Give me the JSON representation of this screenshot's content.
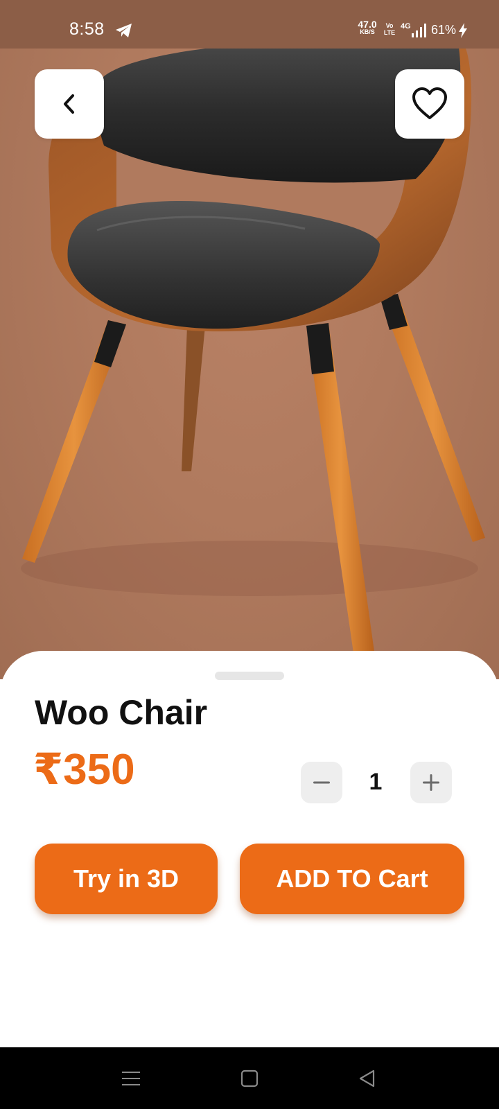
{
  "status_bar": {
    "time": "8:58",
    "network_speed_value": "47.0",
    "network_speed_unit": "KB/S",
    "volte_top": "Vo",
    "volte_bottom": "LTE",
    "network_type": "4G",
    "battery": "61%",
    "icons": [
      "telegram-icon",
      "signal-icon",
      "charging-bolt-icon"
    ]
  },
  "header": {
    "back_icon": "chevron-left-icon",
    "favorite_icon": "heart-outline-icon"
  },
  "product": {
    "image": "wooden-chair-with-black-leather-seat",
    "name": "Woo Chair",
    "price": "₹350",
    "quantity": "1"
  },
  "quantity_controls": {
    "decrement_icon": "minus-icon",
    "increment_icon": "plus-icon"
  },
  "actions": {
    "try_3d_label": "Try in 3D",
    "add_to_cart_label": "ADD TO Cart"
  },
  "navigation_bar": {
    "icons": [
      "menu-lines-icon",
      "square-home-icon",
      "triangle-back-icon"
    ]
  },
  "colors": {
    "accent": "#ec6b17",
    "hero_background": "#b07a5e",
    "status_bar": "#8c5e47",
    "nav_bar": "#000000",
    "qty_button_bg": "#eeeeee"
  }
}
